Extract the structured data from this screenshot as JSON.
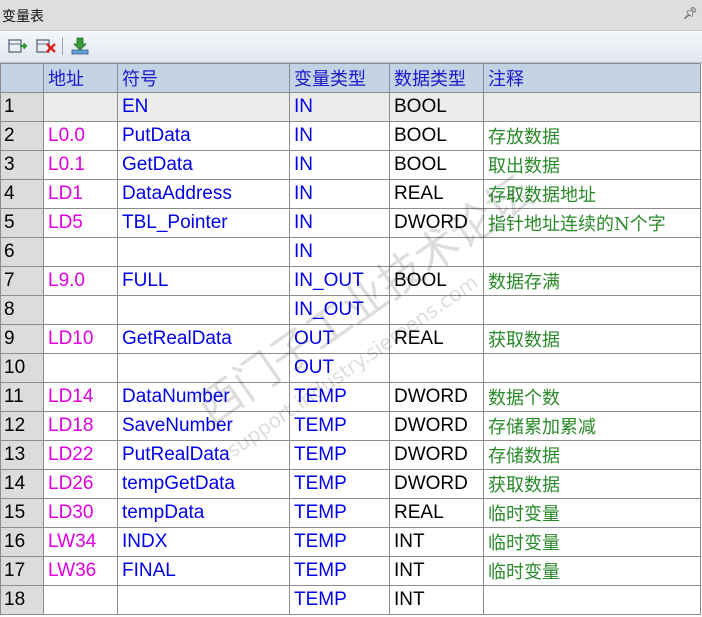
{
  "window": {
    "title": "变量表",
    "pin_icon": "pin-icon"
  },
  "toolbar": {
    "buttons": [
      {
        "name": "insert-row-button",
        "icon": "insert-row-icon"
      },
      {
        "name": "delete-row-button",
        "icon": "delete-row-icon"
      },
      {
        "name": "download-button",
        "icon": "download-icon"
      }
    ]
  },
  "table": {
    "headers": [
      "",
      "地址",
      "符号",
      "变量类型",
      "数据类型",
      "注释"
    ],
    "rows": [
      {
        "num": "1",
        "addr": "",
        "sym": "EN",
        "vtype": "IN",
        "dtype": "BOOL",
        "cmt": ""
      },
      {
        "num": "2",
        "addr": "L0.0",
        "sym": "PutData",
        "vtype": "IN",
        "dtype": "BOOL",
        "cmt": "存放数据"
      },
      {
        "num": "3",
        "addr": "L0.1",
        "sym": "GetData",
        "vtype": "IN",
        "dtype": "BOOL",
        "cmt": "取出数据"
      },
      {
        "num": "4",
        "addr": "LD1",
        "sym": "DataAddress",
        "vtype": "IN",
        "dtype": "REAL",
        "cmt": "存取数据地址"
      },
      {
        "num": "5",
        "addr": "LD5",
        "sym": "TBL_Pointer",
        "vtype": "IN",
        "dtype": "DWORD",
        "cmt": "指针地址连续的N个字"
      },
      {
        "num": "6",
        "addr": "",
        "sym": "",
        "vtype": "IN",
        "dtype": "",
        "cmt": ""
      },
      {
        "num": "7",
        "addr": "L9.0",
        "sym": "FULL",
        "vtype": "IN_OUT",
        "dtype": "BOOL",
        "cmt": "数据存满"
      },
      {
        "num": "8",
        "addr": "",
        "sym": "",
        "vtype": "IN_OUT",
        "dtype": "",
        "cmt": ""
      },
      {
        "num": "9",
        "addr": "LD10",
        "sym": "GetRealData",
        "vtype": "OUT",
        "dtype": "REAL",
        "cmt": "获取数据"
      },
      {
        "num": "10",
        "addr": "",
        "sym": "",
        "vtype": "OUT",
        "dtype": "",
        "cmt": ""
      },
      {
        "num": "11",
        "addr": "LD14",
        "sym": "DataNumber",
        "vtype": "TEMP",
        "dtype": "DWORD",
        "cmt": "数据个数"
      },
      {
        "num": "12",
        "addr": "LD18",
        "sym": "SaveNumber",
        "vtype": "TEMP",
        "dtype": "DWORD",
        "cmt": "存储累加累减"
      },
      {
        "num": "13",
        "addr": "LD22",
        "sym": "PutRealData",
        "vtype": "TEMP",
        "dtype": "DWORD",
        "cmt": "存储数据"
      },
      {
        "num": "14",
        "addr": "LD26",
        "sym": "tempGetData",
        "vtype": "TEMP",
        "dtype": "DWORD",
        "cmt": "获取数据"
      },
      {
        "num": "15",
        "addr": "LD30",
        "sym": "tempData",
        "vtype": "TEMP",
        "dtype": "REAL",
        "cmt": "临时变量"
      },
      {
        "num": "16",
        "addr": "LW34",
        "sym": "INDX",
        "vtype": "TEMP",
        "dtype": "INT",
        "cmt": "临时变量"
      },
      {
        "num": "17",
        "addr": "LW36",
        "sym": "FINAL",
        "vtype": "TEMP",
        "dtype": "INT",
        "cmt": "临时变量"
      },
      {
        "num": "18",
        "addr": "",
        "sym": "",
        "vtype": "TEMP",
        "dtype": "INT",
        "cmt": ""
      }
    ]
  },
  "watermark": {
    "text": "西门子工业技术论坛",
    "url": "support.industry.siemens.com"
  },
  "colors": {
    "address": "#e000e0",
    "symbol": "#0000ee",
    "var_type": "#0000ee",
    "data_type": "#000000",
    "comment": "#2a8a2a",
    "header_bg": "#c4d3e4",
    "header_text": "#1a1acc"
  }
}
